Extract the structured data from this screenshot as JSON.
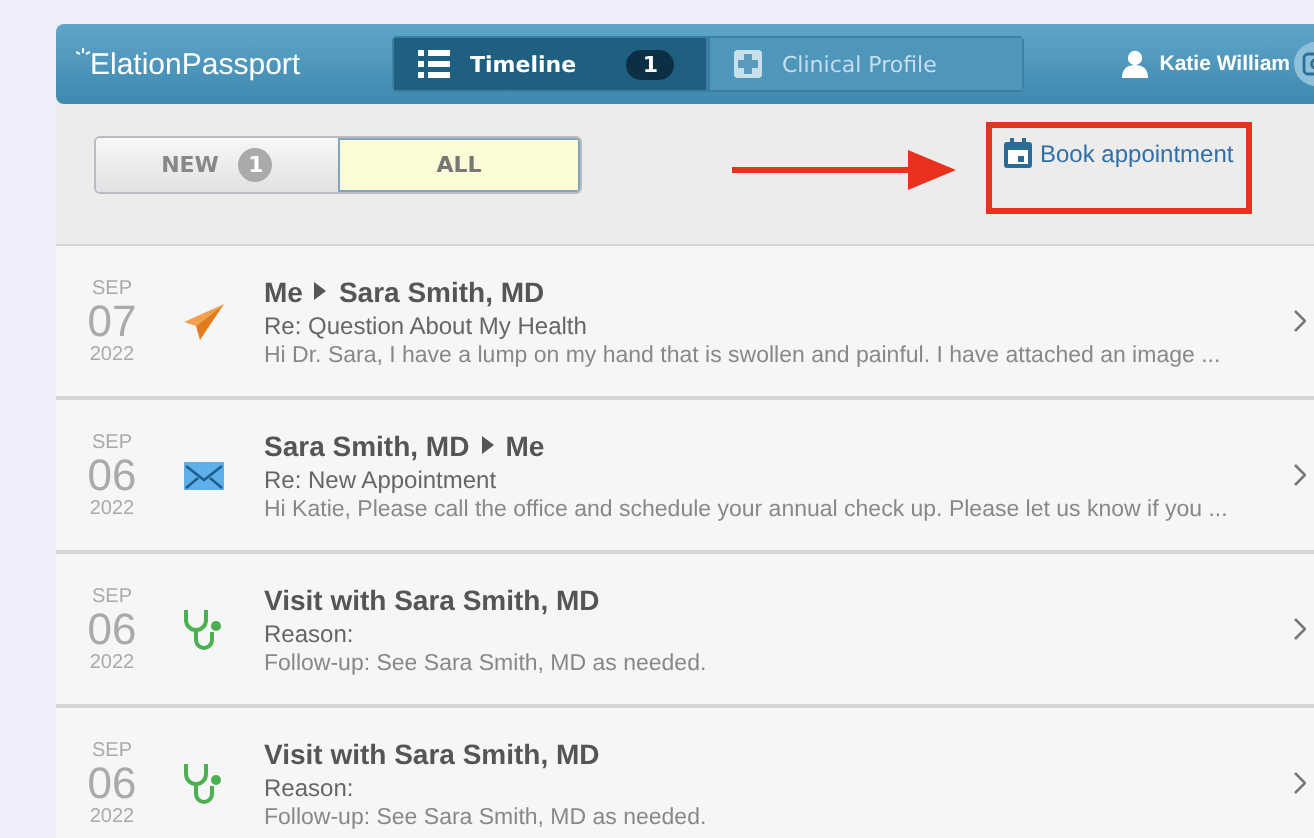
{
  "header": {
    "logo": "**Elation**Passport",
    "tabs": [
      {
        "label": "Timeline",
        "kind": "list",
        "badge": "1",
        "selected": true
      },
      {
        "label": "Clinical Profile",
        "kind": "plus",
        "selected": false
      }
    ],
    "user": "Katie William"
  },
  "filter": {
    "options": [
      {
        "label": "NEW",
        "badge": "1",
        "selected": false
      },
      {
        "label": "ALL",
        "selected": true
      }
    ]
  },
  "book_link": "Book appointment",
  "annotation": {
    "kind": "arrow-box"
  },
  "items": [
    {
      "kind": "sent",
      "month": "SEP",
      "day": "07",
      "year": "2022",
      "from": "Me",
      "to": "Sara Smith, MD",
      "subject": "Re: Question About My Health",
      "preview": "Hi Dr. Sara, I have a lump on my hand that is swollen and painful. I have attached an image ..."
    },
    {
      "kind": "received",
      "month": "SEP",
      "day": "06",
      "year": "2022",
      "from": "Sara Smith, MD",
      "to": "Me",
      "subject": "Re: New Appointment",
      "preview": "Hi Katie, Please call the office and schedule your annual check up. Please let us know if you ..."
    },
    {
      "kind": "visit",
      "month": "SEP",
      "day": "06",
      "year": "2022",
      "title": "Visit with Sara Smith, MD",
      "subject": "Reason:",
      "preview": "Follow-up: See Sara Smith, MD as needed."
    },
    {
      "kind": "visit",
      "month": "SEP",
      "day": "06",
      "year": "2022",
      "title": "Visit with Sara Smith, MD",
      "subject": "Reason:",
      "preview": "Follow-up: See Sara Smith, MD as needed."
    }
  ]
}
